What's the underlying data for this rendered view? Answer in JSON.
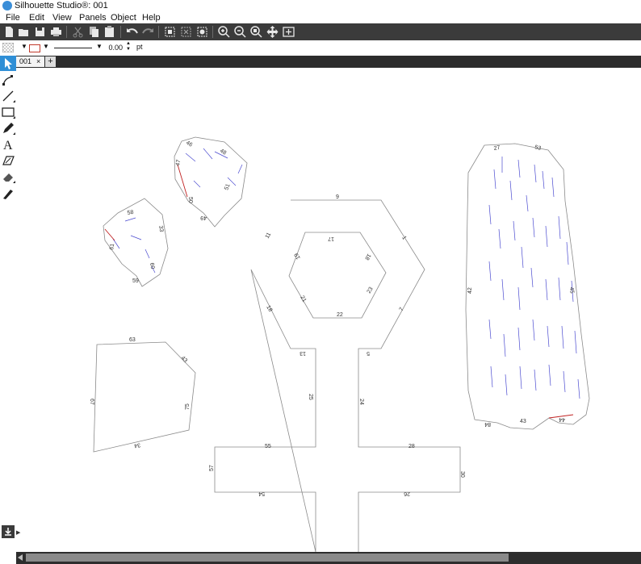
{
  "window": {
    "title": "Silhouette Studio®: 001"
  },
  "menu": [
    {
      "label": "File"
    },
    {
      "label": "Edit"
    },
    {
      "label": "View"
    },
    {
      "label": "Panels"
    },
    {
      "label": "Object"
    },
    {
      "label": "Help"
    }
  ],
  "toolbar": {
    "buttons": [
      {
        "name": "new-document-icon"
      },
      {
        "name": "open-folder-icon"
      },
      {
        "name": "save-icon"
      },
      {
        "name": "print-icon"
      },
      {
        "name": "cut-icon"
      },
      {
        "name": "copy-icon"
      },
      {
        "name": "paste-icon"
      },
      {
        "name": "undo-icon"
      },
      {
        "name": "redo-icon"
      },
      {
        "name": "group-icon"
      },
      {
        "name": "ungroup-icon"
      },
      {
        "name": "select-all-icon"
      },
      {
        "name": "zoom-in-icon"
      },
      {
        "name": "zoom-out-icon"
      },
      {
        "name": "zoom-select-icon"
      },
      {
        "name": "pan-icon"
      },
      {
        "name": "fit-page-icon"
      }
    ]
  },
  "properties": {
    "line_weight_value": "0.00",
    "line_weight_unit": "pt"
  },
  "tabs": {
    "document_tab": "001",
    "close_glyph": "×",
    "add_glyph": "+"
  },
  "tools": [
    {
      "name": "select-arrow-icon"
    },
    {
      "name": "point-edit-icon"
    },
    {
      "name": "line-tool-icon"
    },
    {
      "name": "rectangle-tool-icon"
    },
    {
      "name": "pencil-tool-icon"
    },
    {
      "name": "text-tool-icon"
    },
    {
      "name": "fill-tool-icon"
    },
    {
      "name": "eraser-tool-icon"
    },
    {
      "name": "knife-tool-icon"
    }
  ],
  "canvas": {
    "labels": {
      "hex_top": "9",
      "hex_ul": "11",
      "hex_ur": "1",
      "hex_ll": "18",
      "hex_lr": "7",
      "in_top": "17",
      "in_ul": "19",
      "in_ur": "18",
      "in_ll": "21",
      "in_lr": "23",
      "in_bot": "22",
      "stem_l_top": "13",
      "stem_r_top": "5",
      "stem_l": "25",
      "stem_r": "24",
      "arm_l_top": "55",
      "arm_r_top": "28",
      "arm_l_end": "57",
      "arm_r_end": "30",
      "arm_l_bot": "54",
      "arm_r_bot": "26",
      "quad_top": "63",
      "quad_tr": "43",
      "quad_left": "67",
      "quad_right": "75",
      "quad_bot": "34",
      "leaf1_a": "46",
      "leaf1_b": "48",
      "leaf1_c": "47",
      "leaf1_d": "50",
      "leaf1_e": "51",
      "leaf1_f": "49",
      "leaf2_a": "58",
      "leaf2_b": "33",
      "leaf2_c": "61",
      "leaf2_d": "60",
      "leaf2_e": "59",
      "tall_a": "27",
      "tall_b": "53",
      "tall_c": "42",
      "tall_d": "45",
      "tall_e": "84",
      "tall_f": "43",
      "tall_g": "44"
    }
  }
}
